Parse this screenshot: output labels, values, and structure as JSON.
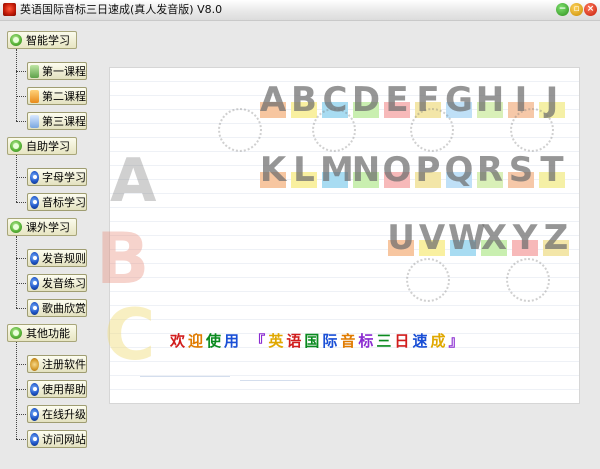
{
  "window": {
    "title": "英语国际音标三日速成(真人发音版) V8.0"
  },
  "sidebar": {
    "groups": [
      {
        "label": "智能学习",
        "items": [
          {
            "label": "第一课程",
            "icon": "lesson-green-icon"
          },
          {
            "label": "第二课程",
            "icon": "lesson-orange-icon"
          },
          {
            "label": "第三课程",
            "icon": "lesson-blue-icon"
          }
        ]
      },
      {
        "label": "自助学习",
        "items": [
          {
            "label": "字母学习",
            "icon": "disc-icon"
          },
          {
            "label": "音标学习",
            "icon": "disc-icon"
          }
        ]
      },
      {
        "label": "课外学习",
        "items": [
          {
            "label": "发音规则",
            "icon": "disc-icon"
          },
          {
            "label": "发音练习",
            "icon": "disc-icon"
          },
          {
            "label": "歌曲欣赏",
            "icon": "disc-icon"
          }
        ]
      },
      {
        "label": "其他功能",
        "items": [
          {
            "label": "注册软件",
            "icon": "gear-icon"
          },
          {
            "label": "使用帮助",
            "icon": "disc-icon"
          },
          {
            "label": "在线升级",
            "icon": "disc-icon"
          },
          {
            "label": "访问网站",
            "icon": "disc-icon"
          }
        ]
      }
    ]
  },
  "banner": {
    "row1": [
      "A",
      "B",
      "C",
      "D",
      "E",
      "F",
      "G",
      "H",
      "I",
      "J"
    ],
    "row2": [
      "K",
      "L",
      "M",
      "N",
      "O",
      "P",
      "Q",
      "R",
      "S",
      "T"
    ],
    "row3": [
      "U",
      "V",
      "W",
      "X",
      "Y",
      "Z"
    ],
    "deco_letters": [
      "A",
      "B",
      "C"
    ],
    "welcome_prefix": "欢迎使用",
    "welcome_title": "『英语国际音标三日速成』"
  },
  "colors": {
    "pastels": [
      "#f7c6a0",
      "#f9f0a0",
      "#a8dcf2",
      "#c9efb0",
      "#f7b9b9",
      "#f3e6a8",
      "#bfe0f7",
      "#d9f0b8",
      "#f6c8a8",
      "#f5f0a6"
    ],
    "welcome": [
      "#d11d1d",
      "#e07b00",
      "#0a8a1f",
      "#1a4fd6",
      "#8a2bd1",
      "#e0a800",
      "#d11d1d",
      "#0a8a1f",
      "#1a4fd6",
      "#e07b00",
      "#8a2bd1",
      "#0a8a1f",
      "#d11d1d",
      "#1a4fd6",
      "#e0a800",
      "#8a2bd1"
    ]
  }
}
